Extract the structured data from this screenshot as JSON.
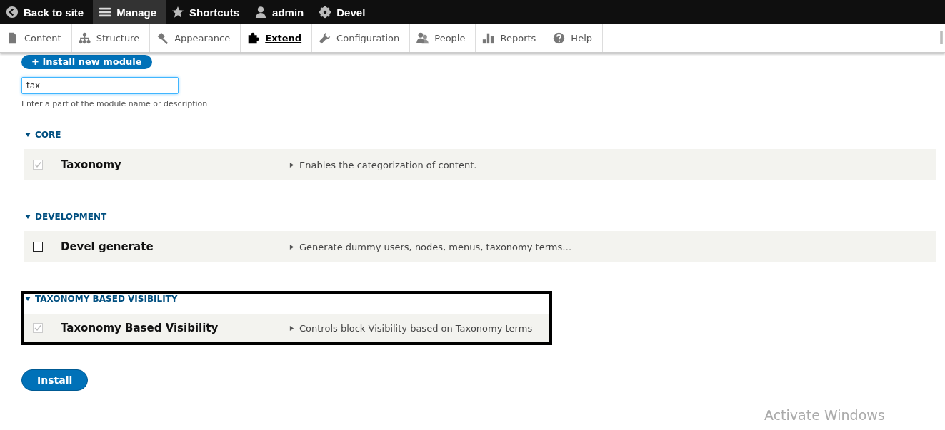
{
  "toolbar": {
    "items": [
      {
        "label": "Back to site",
        "kind": "back",
        "selected": false
      },
      {
        "label": "Manage",
        "kind": "menu",
        "selected": true
      },
      {
        "label": "Shortcuts",
        "kind": "star",
        "selected": false
      },
      {
        "label": "admin",
        "kind": "user",
        "selected": false
      },
      {
        "label": "Devel",
        "kind": "gear",
        "selected": false
      }
    ]
  },
  "tray": {
    "items": [
      {
        "label": "Content",
        "kind": "page",
        "selected": false
      },
      {
        "label": "Structure",
        "kind": "tree",
        "selected": false
      },
      {
        "label": "Appearance",
        "kind": "brush",
        "selected": false
      },
      {
        "label": "Extend",
        "kind": "puzzle",
        "selected": true
      },
      {
        "label": "Configuration",
        "kind": "wrench",
        "selected": false
      },
      {
        "label": "People",
        "kind": "people",
        "selected": false
      },
      {
        "label": "Reports",
        "kind": "bars",
        "selected": false
      },
      {
        "label": "Help",
        "kind": "help",
        "selected": false
      }
    ]
  },
  "install_new_button": "+ Install new module",
  "filter": {
    "value": "tax",
    "description": "Enter a part of the module name or description"
  },
  "groups": [
    {
      "title": "CORE",
      "highlighted": false,
      "modules": [
        {
          "name": "Taxonomy",
          "description": "Enables the categorization of content.",
          "checked": true,
          "disabled": true
        }
      ]
    },
    {
      "title": "DEVELOPMENT",
      "highlighted": false,
      "modules": [
        {
          "name": "Devel generate",
          "description": "Generate dummy users, nodes, menus, taxonomy terms…",
          "checked": false,
          "disabled": false
        }
      ]
    },
    {
      "title": "TAXONOMY BASED VISIBILITY",
      "highlighted": true,
      "modules": [
        {
          "name": "Taxonomy Based Visibility",
          "description": "Controls block Visibility based on Taxonomy terms",
          "checked": true,
          "disabled": true
        }
      ]
    }
  ],
  "install_button": "Install",
  "os_notice": "Activate Windows"
}
